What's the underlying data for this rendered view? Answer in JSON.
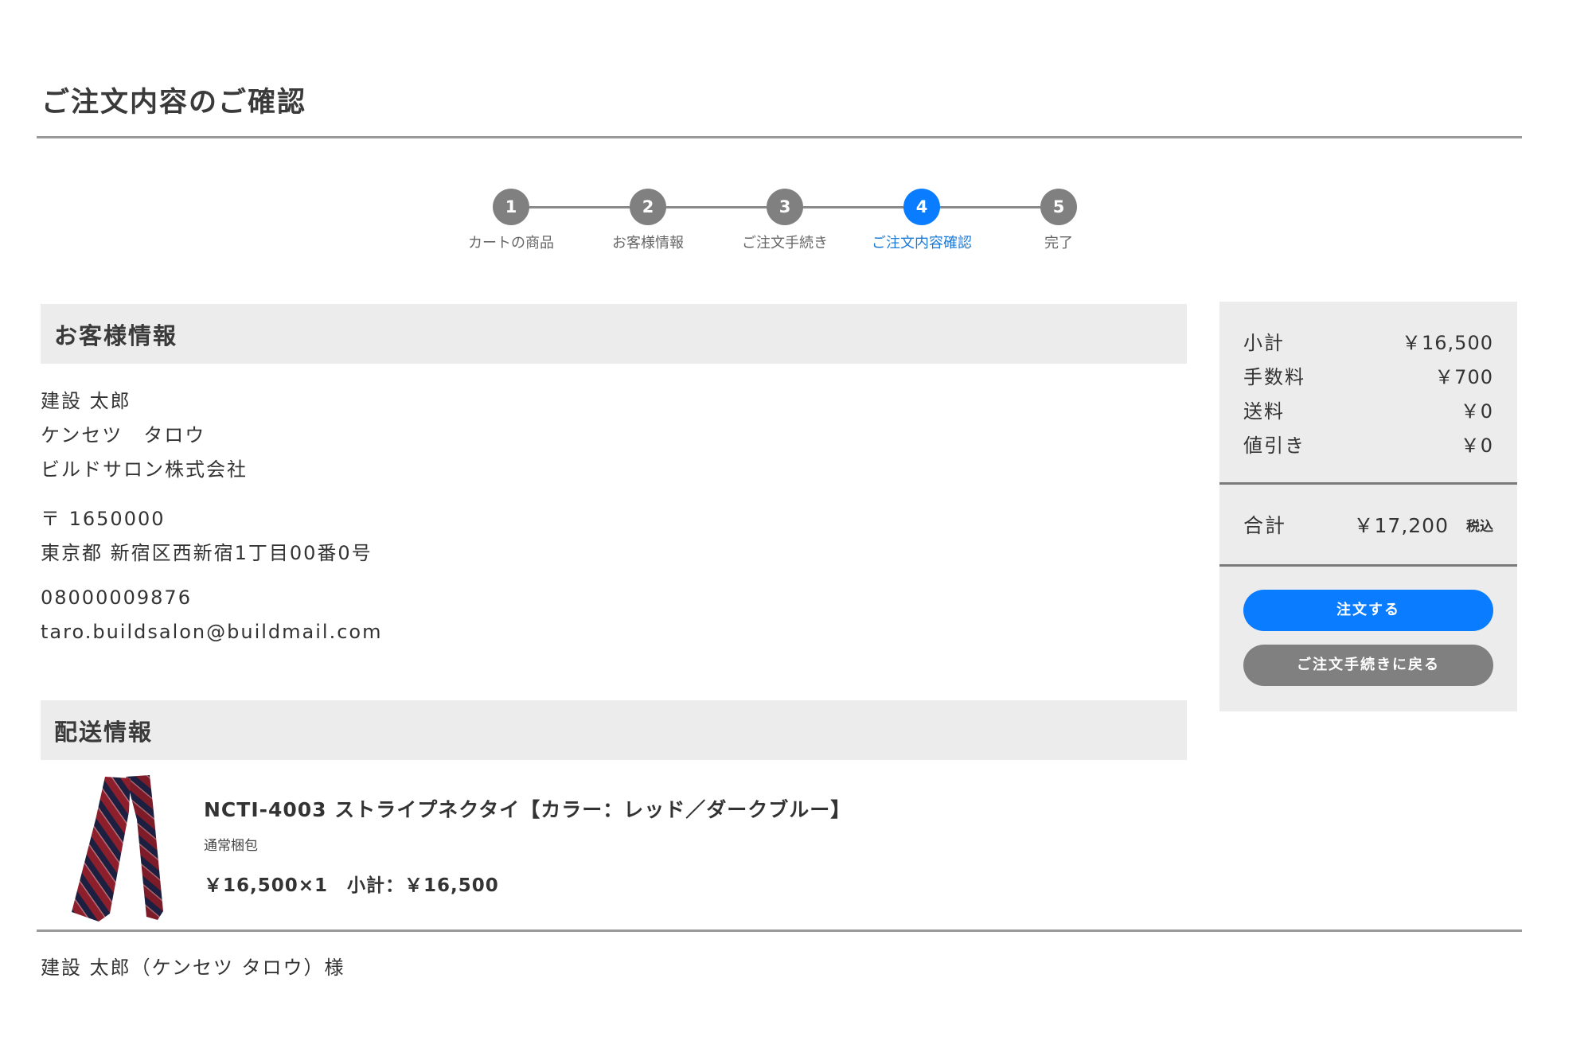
{
  "page": {
    "title": "ご注文内容のご確認"
  },
  "stepper": {
    "steps": [
      {
        "number": "1",
        "label": "カートの商品",
        "active": false
      },
      {
        "number": "2",
        "label": "お客様情報",
        "active": false
      },
      {
        "number": "3",
        "label": "ご注文手続き",
        "active": false
      },
      {
        "number": "4",
        "label": "ご注文内容確認",
        "active": true
      },
      {
        "number": "5",
        "label": "完了",
        "active": false
      }
    ],
    "current_step": 4,
    "total_steps": 5,
    "active_color": "#0a7cff",
    "inactive_color": "#808080"
  },
  "customer": {
    "heading": "お客様情報",
    "name": "建設 太郎",
    "name_kana": "ケンセツ　タロウ",
    "company": "ビルドサロン株式会社",
    "postal": "〒 1650000",
    "address": "東京都 新宿区西新宿1丁目00番0号",
    "phone": "08000009876",
    "email": "taro.buildsalon@buildmail.com"
  },
  "shipping": {
    "heading": "配送情報",
    "item": {
      "name": "NCTI-4003 ストライプネクタイ【カラー：レッド／ダークブルー】",
      "packing": "通常梱包",
      "unit_price_qty": "￥16,500×1",
      "subtotal": "小計：￥16,500",
      "image_icon": "striped-necktie-image"
    },
    "recipient": "建設 太郎（ケンセツ タロウ）様"
  },
  "summary": {
    "rows": [
      {
        "label": "小計",
        "value": "￥16,500"
      },
      {
        "label": "手数料",
        "value": "￥700"
      },
      {
        "label": "送料",
        "value": "￥0"
      },
      {
        "label": "値引き",
        "value": "￥0"
      }
    ],
    "total_label": "合計",
    "total_value": "￥17,200",
    "tax_note": "税込",
    "order_button": "注文する",
    "back_button": "ご注文手続きに戻る",
    "primary_color": "#0a7cff",
    "secondary_color": "#808080"
  }
}
